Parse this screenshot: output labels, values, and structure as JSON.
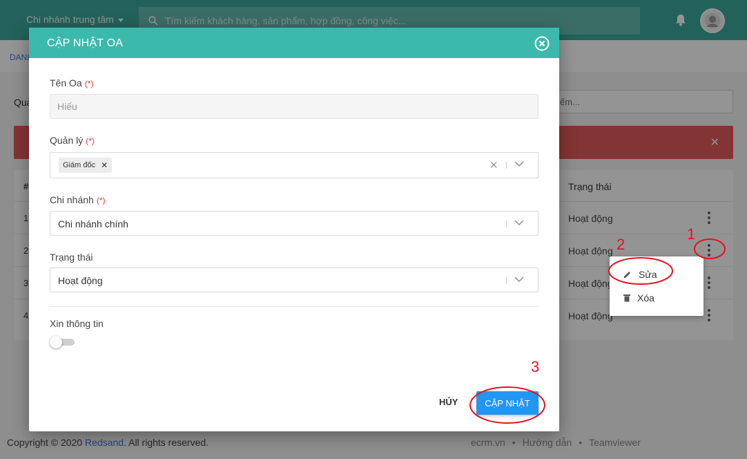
{
  "topbar": {
    "branch": "Chi nhánh trung tâm",
    "search_placeholder": "Tìm kiếm khách hàng, sản phẩm, hợp đồng, công việc..."
  },
  "background": {
    "breadcrumb": "DANH",
    "filter_label": "Quả",
    "search_placeholder": "ếm...",
    "table": {
      "hash_header": "#",
      "status_header": "Trạng thái",
      "rows": [
        {
          "num": "1",
          "status": "Hoạt động"
        },
        {
          "num": "2",
          "status": "Hoạt động"
        },
        {
          "num": "3",
          "status": "Hoạt động"
        },
        {
          "num": "4",
          "status": "Hoạt động"
        }
      ]
    },
    "footer": {
      "copyright_prefix": "Copyright © 2020 ",
      "brand": "Redsand",
      "copyright_suffix": ". All rights reserved.",
      "links": [
        "ecrm.vn",
        "•",
        "Hướng dẫn",
        "•",
        "Teamviewer"
      ]
    }
  },
  "context_menu": {
    "edit_label": "Sửa",
    "delete_label": "Xóa"
  },
  "modal": {
    "title": "CẬP NHẬT OA",
    "required_mark": "(*)",
    "name_label": "Tên Oa",
    "name_value": "Hiếu",
    "manager_label": "Quản lý",
    "manager_tag": "Giám đốc",
    "branch_label": "Chi nhánh",
    "branch_value": "Chi nhánh chính",
    "status_label": "Trạng thái",
    "status_value": "Hoạt động",
    "info_label": "Xin thông tin",
    "cancel_label": "HỦY",
    "submit_label": "CẬP NHẬT"
  },
  "annotations": {
    "step1": "1",
    "step2": "2",
    "step3": "3",
    "color": "#e0141e"
  },
  "colors": {
    "header": "#3ba99c",
    "modal_header": "#3cb9ad",
    "alert": "#e25a5a",
    "primary_button": "#2196f3",
    "link": "#3b7dd8"
  }
}
